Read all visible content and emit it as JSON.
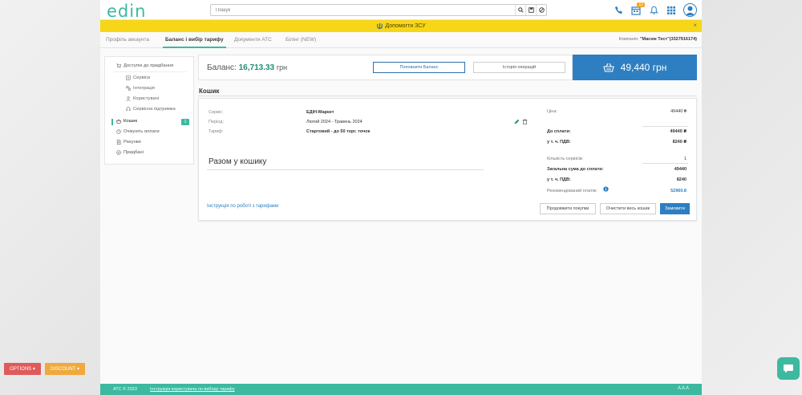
{
  "header": {
    "logo": "edin",
    "search_placeholder": "Пошук",
    "notif_badge": "12"
  },
  "banner": {
    "text": "Допомогти ЗСУ",
    "close": "×"
  },
  "tabs": {
    "items": [
      {
        "label": "Профіль аккаунта"
      },
      {
        "label": "Баланс і вибір тарифу"
      },
      {
        "label": "Документи АТС"
      },
      {
        "label": "Білінг (NEW)"
      }
    ],
    "company_label": "Компанія:",
    "company_name": "\"Масюк Тест\"(3327916174)"
  },
  "sidebar": {
    "available": "Доступні до придбання",
    "services": "Сервіси",
    "integrations": "Інтеграція",
    "users": "Користувачі",
    "support": "Сервісна підтримка",
    "cart": "Кошик",
    "cart_count": "1",
    "awaiting": "Очікують оплати",
    "invoices": "Рахунки",
    "purchased": "Придбані"
  },
  "balance": {
    "label": "Баланс:",
    "amount": "16,713.33",
    "currency": "грн",
    "topup": "Поповнити Баланс",
    "history": "Історія операцій",
    "total": "49,440 грн"
  },
  "cart": {
    "heading": "Кошик",
    "service_label": "Сервіс:",
    "service_value": "ЕДІН-Маркет",
    "period_label": "Період:",
    "period_value": "Лютий 2024 - Травень 2024",
    "tariff_label": "Тариф:",
    "tariff_value": "Стартовий - до 50 торг. точок",
    "price_label": "Ціна:",
    "price_value": "49440 ₴",
    "to_pay_label": "До сплати:",
    "to_pay_value": "49440 ₴",
    "vat_label": "у т. ч. ПДВ:",
    "vat_value": "8240 ₴",
    "subtotal_title": "Разом у кошику",
    "count_label": "Кількість сервісів:",
    "count_value": "1",
    "grand_label": "Загальна сума до сплати:",
    "grand_value": "49440",
    "grand_vat_label": "у т. ч. ПДВ:",
    "grand_vat_value": "8240",
    "recommended_label": "Рекомендований платіж:",
    "recommended_value": "52960.8",
    "instruction_link": "Інструкція по роботі з тарифами",
    "continue_btn": "Продовжити покупки",
    "clear_btn": "Очистити весь кошик",
    "order_btn": "Замовити"
  },
  "footer": {
    "copyright": "АТС © 2023",
    "link": "Інструкція користувача по вибору тарифу",
    "font_sizes": "A A A"
  },
  "floating": {
    "options": "OPTIONS ▾",
    "discount": "DISCOUNT ▾"
  },
  "colors": {
    "brand": "#3db9a0",
    "primary": "#2e7fc1",
    "banner": "#f7d618"
  }
}
